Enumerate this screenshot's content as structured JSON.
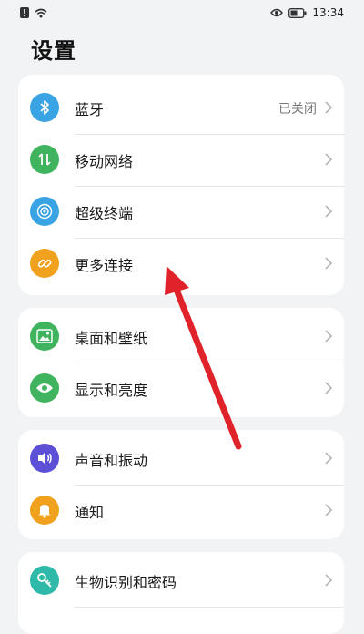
{
  "status_bar": {
    "time": "13:34"
  },
  "page_title": "设置",
  "groups": [
    {
      "items": [
        {
          "label": "蓝牙",
          "value": "已关闭",
          "icon": "bluetooth-icon",
          "color": "#3aa3e3"
        },
        {
          "label": "移动网络",
          "icon": "mobile-network-icon",
          "color": "#3fb35e"
        },
        {
          "label": "超级终端",
          "icon": "super-device-icon",
          "color": "#3aa3e3"
        },
        {
          "label": "更多连接",
          "icon": "link-icon",
          "color": "#f0a21e"
        }
      ]
    },
    {
      "items": [
        {
          "label": "桌面和壁纸",
          "icon": "wallpaper-icon",
          "color": "#3fb35e"
        },
        {
          "label": "显示和亮度",
          "icon": "eye-icon",
          "color": "#3fb35e"
        }
      ]
    },
    {
      "items": [
        {
          "label": "声音和振动",
          "icon": "speaker-icon",
          "color": "#5b50d6"
        },
        {
          "label": "通知",
          "icon": "bell-icon",
          "color": "#f0a21e"
        }
      ]
    },
    {
      "items": [
        {
          "label": "生物识别和密码",
          "icon": "key-icon",
          "color": "#2fb9a8"
        }
      ]
    }
  ],
  "annotation_arrow_color": "#e0232a"
}
